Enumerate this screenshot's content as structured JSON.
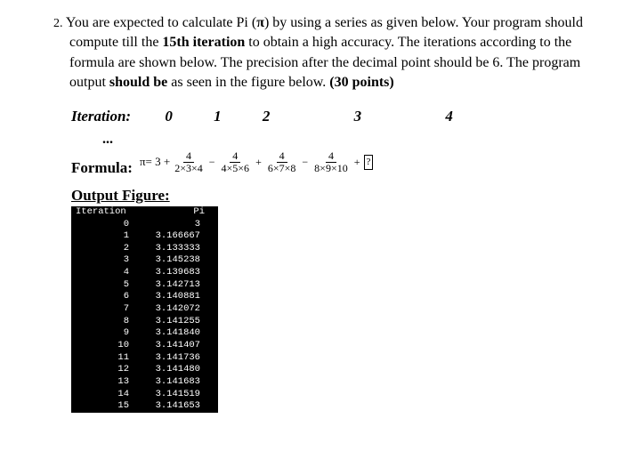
{
  "problem": {
    "number": "2.",
    "text_parts": [
      "You are expected to calculate Pi (",
      ") by using a series as given below. Your program should compute till the ",
      " to obtain a high accuracy. The iterations according to the formula are shown below. The precision after the decimal point should be 6. The program output ",
      " as seen in the figure below. "
    ],
    "pi_symbol": "π",
    "bold_15th": "15th iteration",
    "bold_should_be": "should be",
    "bold_points": "(30 points)"
  },
  "iteration_label": "Iteration:",
  "iteration_numbers": [
    "0",
    "1",
    "2",
    "3",
    "4"
  ],
  "ellipsis": "...",
  "formula": {
    "label": "Formula:",
    "pi": "π",
    "eq": " = 3 + ",
    "terms": [
      {
        "num": "4",
        "den": "2×3×4"
      },
      {
        "num": "4",
        "den": "4×5×6"
      },
      {
        "num": "4",
        "den": "6×7×8"
      },
      {
        "num": "4",
        "den": "8×9×10"
      }
    ],
    "ops": [
      "−",
      "+",
      "−",
      "+"
    ],
    "question": "?"
  },
  "output": {
    "label": "Output Figure:",
    "header": {
      "col1": "Iteration",
      "col2": "Pi"
    },
    "rows": [
      {
        "iter": "0",
        "pi": "3"
      },
      {
        "iter": "1",
        "pi": "3.166667"
      },
      {
        "iter": "2",
        "pi": "3.133333"
      },
      {
        "iter": "3",
        "pi": "3.145238"
      },
      {
        "iter": "4",
        "pi": "3.139683"
      },
      {
        "iter": "5",
        "pi": "3.142713"
      },
      {
        "iter": "6",
        "pi": "3.140881"
      },
      {
        "iter": "7",
        "pi": "3.142072"
      },
      {
        "iter": "8",
        "pi": "3.141255"
      },
      {
        "iter": "9",
        "pi": "3.141840"
      },
      {
        "iter": "10",
        "pi": "3.141407"
      },
      {
        "iter": "11",
        "pi": "3.141736"
      },
      {
        "iter": "12",
        "pi": "3.141480"
      },
      {
        "iter": "13",
        "pi": "3.141683"
      },
      {
        "iter": "14",
        "pi": "3.141519"
      },
      {
        "iter": "15",
        "pi": "3.141653"
      }
    ]
  },
  "chart_data": {
    "type": "table",
    "title": "Output Figure",
    "columns": [
      "Iteration",
      "Pi"
    ],
    "rows": [
      [
        "0",
        "3"
      ],
      [
        "1",
        "3.166667"
      ],
      [
        "2",
        "3.133333"
      ],
      [
        "3",
        "3.145238"
      ],
      [
        "4",
        "3.139683"
      ],
      [
        "5",
        "3.142713"
      ],
      [
        "6",
        "3.140881"
      ],
      [
        "7",
        "3.142072"
      ],
      [
        "8",
        "3.141255"
      ],
      [
        "9",
        "3.141840"
      ],
      [
        "10",
        "3.141407"
      ],
      [
        "11",
        "3.141736"
      ],
      [
        "12",
        "3.141480"
      ],
      [
        "13",
        "3.141683"
      ],
      [
        "14",
        "3.141519"
      ],
      [
        "15",
        "3.141653"
      ]
    ]
  }
}
